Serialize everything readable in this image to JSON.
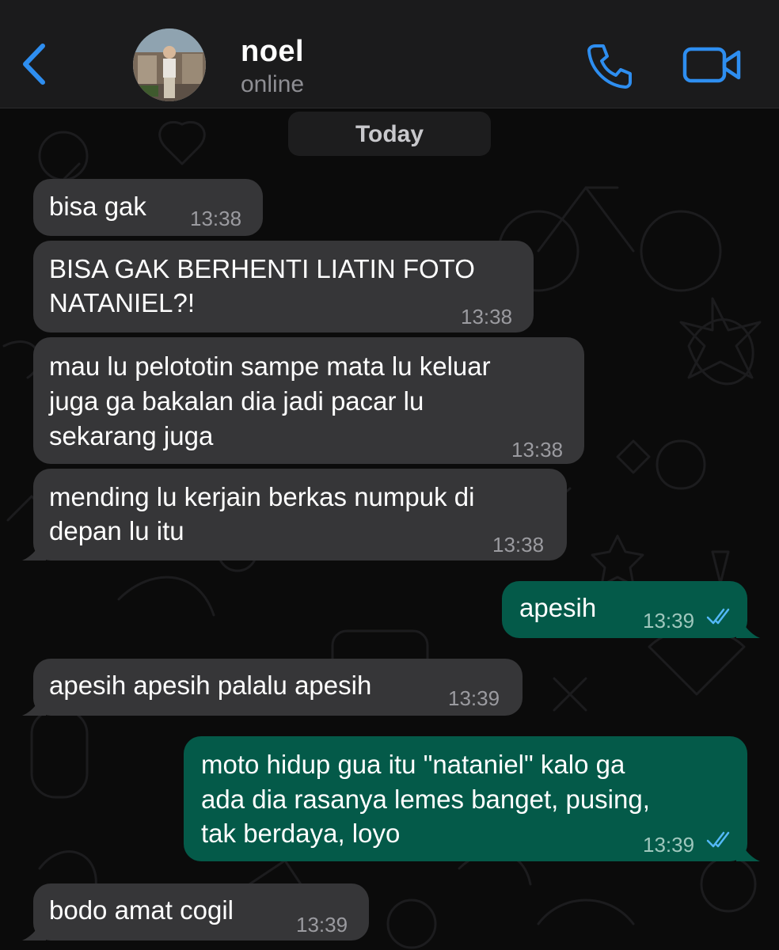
{
  "header": {
    "contact_name": "noel",
    "contact_status": "online"
  },
  "icons": {
    "back": "chevron-left-icon",
    "call": "phone-icon",
    "video": "video-camera-icon",
    "read_receipt": "double-check-icon"
  },
  "colors": {
    "accent": "#2e8ef0",
    "header_bg": "#1b1b1c",
    "incoming_bubble": "#363638",
    "outgoing_bubble": "#045a49",
    "read_tick": "#53b8f6"
  },
  "chat": {
    "date_label": "Today",
    "messages": [
      {
        "id": "m1",
        "direction": "incoming",
        "lines": [
          "bisa gak"
        ],
        "time": "13:38"
      },
      {
        "id": "m2",
        "direction": "incoming",
        "lines": [
          "BISA GAK BERHENTI LIATIN FOTO",
          "NATANIEL?!"
        ],
        "time": "13:38"
      },
      {
        "id": "m3",
        "direction": "incoming",
        "lines": [
          "mau lu pelototin sampe mata lu keluar",
          "juga ga bakalan dia jadi pacar lu",
          "sekarang juga"
        ],
        "time": "13:38"
      },
      {
        "id": "m4",
        "direction": "incoming",
        "lines": [
          "mending lu kerjain berkas numpuk di",
          "depan lu itu"
        ],
        "time": "13:38"
      },
      {
        "id": "m5",
        "direction": "outgoing",
        "lines": [
          "apesih"
        ],
        "time": "13:39",
        "read": true
      },
      {
        "id": "m6",
        "direction": "incoming",
        "lines": [
          "apesih apesih palalu apesih"
        ],
        "time": "13:39"
      },
      {
        "id": "m7",
        "direction": "outgoing",
        "lines": [
          "moto hidup gua itu \"nataniel\" kalo ga",
          "ada dia rasanya lemes banget, pusing,",
          "tak berdaya, loyo"
        ],
        "time": "13:39",
        "read": true
      },
      {
        "id": "m8",
        "direction": "incoming",
        "lines": [
          "bodo amat cogil"
        ],
        "time": "13:39"
      }
    ]
  }
}
